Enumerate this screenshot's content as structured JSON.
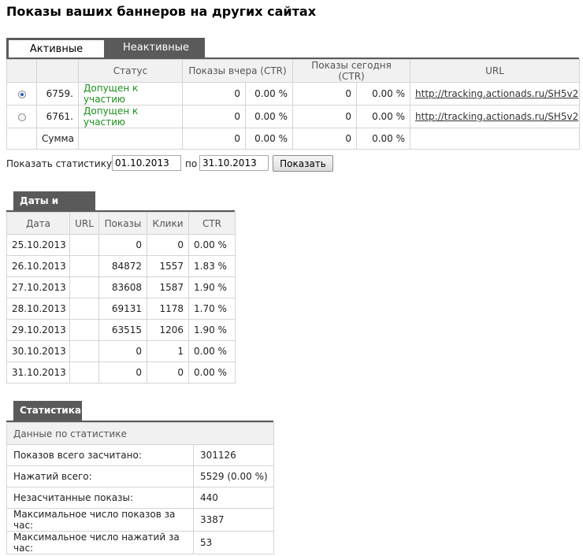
{
  "title": "Показы ваших баннеров на других сайтах",
  "tabs": {
    "active": "Активные",
    "inactive": "Неактивные"
  },
  "banner_table": {
    "headers": [
      "",
      "",
      "Статус",
      "Показы вчера (CTR)",
      "",
      "Показы сегодня (CTR)",
      "",
      "URL"
    ],
    "rows": [
      {
        "checked": true,
        "id": "6759.",
        "status": "Допущен к участию",
        "yest_shows": "0",
        "yest_ctr": "0.00 %",
        "today_shows": "0",
        "today_ctr": "0.00 %",
        "url": "http://tracking.actionads.ru/SH5v2"
      },
      {
        "checked": false,
        "id": "6761.",
        "status": "Допущен к участию",
        "yest_shows": "0",
        "yest_ctr": "0.00 %",
        "today_shows": "0",
        "today_ctr": "0.00 %",
        "url": "http://tracking.actionads.ru/SH5v2"
      }
    ],
    "sum": {
      "label": "Сумма",
      "yest_shows": "0",
      "yest_ctr": "0.00 %",
      "today_shows": "0",
      "today_ctr": "0.00 %"
    }
  },
  "period": {
    "label_from": "Показать статистику с",
    "from": "01.10.2013",
    "label_to": "по",
    "to": "31.10.2013",
    "button": "Показать"
  },
  "dates_section": {
    "title": "Даты и сайты",
    "headers": [
      "Дата",
      "URL",
      "Показы",
      "Клики",
      "CTR"
    ],
    "rows": [
      {
        "date": "25.10.2013",
        "url": "",
        "shows": "0",
        "clicks": "0",
        "ctr": "0.00 %"
      },
      {
        "date": "26.10.2013",
        "url": "",
        "shows": "84872",
        "clicks": "1557",
        "ctr": "1.83 %"
      },
      {
        "date": "27.10.2013",
        "url": "",
        "shows": "83608",
        "clicks": "1587",
        "ctr": "1.90 %"
      },
      {
        "date": "28.10.2013",
        "url": "",
        "shows": "69131",
        "clicks": "1178",
        "ctr": "1.70 %"
      },
      {
        "date": "29.10.2013",
        "url": "",
        "shows": "63515",
        "clicks": "1206",
        "ctr": "1.90 %"
      },
      {
        "date": "30.10.2013",
        "url": "",
        "shows": "0",
        "clicks": "1",
        "ctr": "0.00 %"
      },
      {
        "date": "31.10.2013",
        "url": "",
        "shows": "0",
        "clicks": "0",
        "ctr": "0.00 %"
      }
    ]
  },
  "stats_section": {
    "title": "Статистика",
    "header": "Данные по статистике",
    "rows": [
      {
        "label": "Показов всего засчитано:",
        "value": "301126"
      },
      {
        "label": "Нажатий всего:",
        "value": "5529 (0.00 %)"
      },
      {
        "label": "Незасчитанные показы:",
        "value": "440"
      },
      {
        "label": "Максимальное число показов за час:",
        "value": "3387"
      },
      {
        "label": "Максимальное число нажатий за час:",
        "value": "53"
      }
    ]
  },
  "colors": {
    "tab_dark": "#5a5a5a",
    "status_green": "#1e8e1e",
    "header_bg": "#f1f1f1",
    "border": "#d4d4d4"
  }
}
